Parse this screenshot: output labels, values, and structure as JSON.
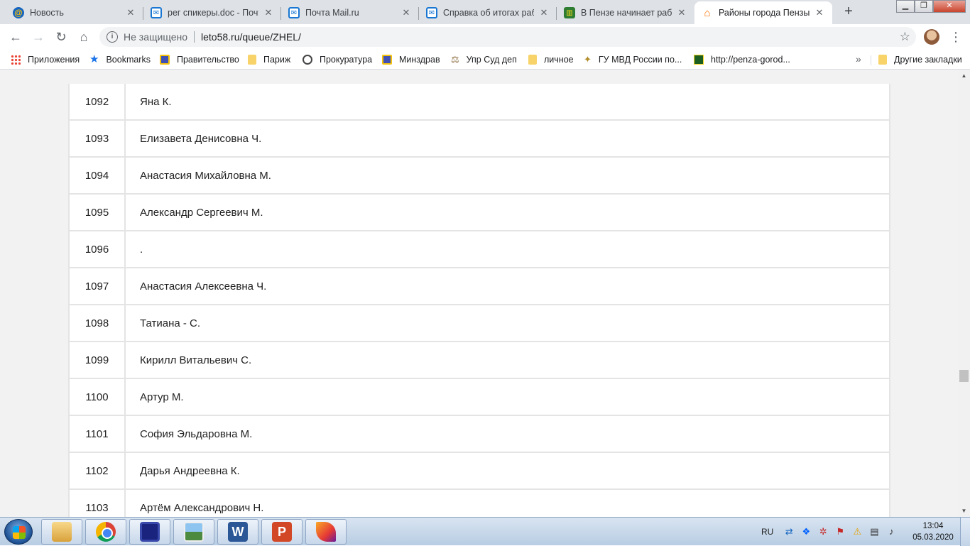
{
  "browser": {
    "tabs": [
      {
        "title": "Новость",
        "icon": "mail-ru-at-icon"
      },
      {
        "title": "рег спикеры.doc - Почт",
        "icon": "mail-envelope-icon"
      },
      {
        "title": "Почта Mail.ru",
        "icon": "mail-envelope-icon"
      },
      {
        "title": "Справка об итогах рабо",
        "icon": "mail-envelope-icon"
      },
      {
        "title": "В Пензе начинает рабо",
        "icon": "coat-of-arms-icon"
      },
      {
        "title": "Районы города Пензы",
        "icon": "home-icon",
        "active": true
      }
    ],
    "security_label": "Не защищено",
    "url": "leto58.ru/queue/ZHEL/",
    "bookmarks": [
      {
        "label": "Приложения",
        "icon": "apps-grid-icon"
      },
      {
        "label": "Bookmarks",
        "icon": "star-icon"
      },
      {
        "label": "Правительство",
        "icon": "coat-of-arms-icon"
      },
      {
        "label": "Париж",
        "icon": "folder-icon"
      },
      {
        "label": "Прокуратура",
        "icon": "globe-icon"
      },
      {
        "label": "Минздрав",
        "icon": "coat-of-arms-icon"
      },
      {
        "label": "Упр Суд деп",
        "icon": "scales-icon"
      },
      {
        "label": "личное",
        "icon": "folder-icon"
      },
      {
        "label": "ГУ МВД России по...",
        "icon": "mvd-emblem-icon"
      },
      {
        "label": "http://penza-gorod...",
        "icon": "coat-of-arms-icon"
      }
    ],
    "more_bookmarks_glyph": "»",
    "other_bookmarks": "Другие закладки"
  },
  "queue": {
    "rows": [
      {
        "number": "1092",
        "name": "Яна К."
      },
      {
        "number": "1093",
        "name": "Елизавета Денисовна Ч."
      },
      {
        "number": "1094",
        "name": "Анастасия Михайловна М."
      },
      {
        "number": "1095",
        "name": "Александр Сергеевич М."
      },
      {
        "number": "1096",
        "name": "."
      },
      {
        "number": "1097",
        "name": "Анастасия Алексеевна Ч."
      },
      {
        "number": "1098",
        "name": "Татиана - С."
      },
      {
        "number": "1099",
        "name": "Кирилл Витальевич С."
      },
      {
        "number": "1100",
        "name": "Артур М."
      },
      {
        "number": "1101",
        "name": "София Эльдаровна М."
      },
      {
        "number": "1102",
        "name": "Дарья Андреевна К."
      },
      {
        "number": "1103",
        "name": "Артём Александрович Н."
      }
    ]
  },
  "taskbar": {
    "apps": [
      "file-explorer-icon",
      "chrome-icon",
      "save-disk-icon",
      "picture-viewer-icon",
      "word-icon",
      "powerpoint-icon",
      "feather-app-icon"
    ],
    "word_glyph": "W",
    "powerpoint_glyph": "P",
    "language": "RU",
    "time": "13:04",
    "date": "05.03.2020"
  }
}
